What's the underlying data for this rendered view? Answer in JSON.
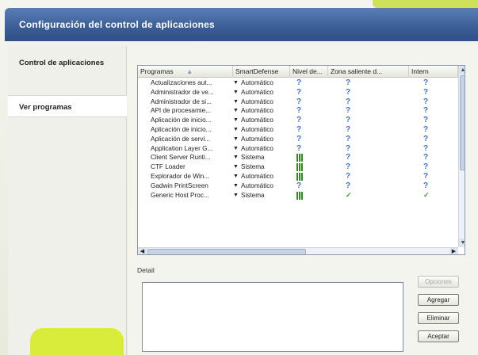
{
  "window": {
    "title": "Configuración del control de aplicaciones"
  },
  "nav": {
    "control_label": "Control de aplicaciones",
    "ver_label": "Ver programas"
  },
  "table": {
    "columns": [
      "Programas",
      "SmartDefense",
      "Nivel de...",
      "Zona saliente d...",
      "Intern"
    ],
    "sort_arrow": "▲",
    "rows": [
      {
        "name": "Actualizaciones aut...",
        "smart": "Automático",
        "level": "?",
        "zone": "?",
        "inet": "?"
      },
      {
        "name": "Administrador de ve...",
        "smart": "Automático",
        "level": "?",
        "zone": "?",
        "inet": "?"
      },
      {
        "name": "Administrador de si...",
        "smart": "Automático",
        "level": "?",
        "zone": "?",
        "inet": "?"
      },
      {
        "name": "API de procesamie...",
        "smart": "Automático",
        "level": "?",
        "zone": "?",
        "inet": "?"
      },
      {
        "name": "Aplicación de inicio...",
        "smart": "Automático",
        "level": "?",
        "zone": "?",
        "inet": "?"
      },
      {
        "name": "Aplicación de inicio...",
        "smart": "Automático",
        "level": "?",
        "zone": "?",
        "inet": "?"
      },
      {
        "name": "Aplicación de servi...",
        "smart": "Automático",
        "level": "?",
        "zone": "?",
        "inet": "?"
      },
      {
        "name": "Application Layer G...",
        "smart": "Automático",
        "level": "?",
        "zone": "?",
        "inet": "?"
      },
      {
        "name": "Client Server Runti...",
        "smart": "Sistema",
        "level": "bars",
        "zone": "?",
        "inet": "?"
      },
      {
        "name": "CTF Loader",
        "smart": "Sistema",
        "level": "bars",
        "zone": "?",
        "inet": "?"
      },
      {
        "name": "Explorador de Win...",
        "smart": "Automático",
        "level": "bars",
        "zone": "?",
        "inet": "?"
      },
      {
        "name": "Gadwin PrintScreen",
        "smart": "Automático",
        "level": "?",
        "zone": "?",
        "inet": "?"
      },
      {
        "name": "Generic Host Proc...",
        "smart": "Sistema",
        "level": "bars",
        "zone": "✓",
        "inet": "✓"
      }
    ]
  },
  "detail": {
    "label": "Detail"
  },
  "buttons": {
    "opciones": "Opciones",
    "agregar": "Agregar",
    "eliminar": "Eliminar",
    "aceptar": "Aceptar"
  },
  "colors": {
    "title_bar": "#3c5f98",
    "accent_green": "#d9ec3a",
    "question": "#3f6fd0",
    "check": "#3a9c2a"
  }
}
